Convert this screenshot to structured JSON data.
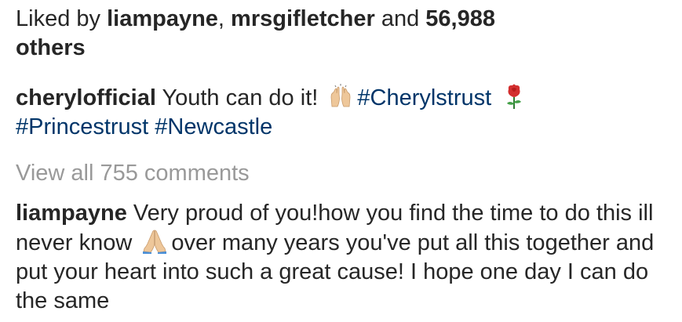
{
  "likes": {
    "prefix": "Liked by ",
    "user1": "liampayne",
    "sep": ", ",
    "user2": "mrsgifletcher",
    "and": " and ",
    "count": "56,988",
    "others": "others"
  },
  "caption": {
    "username": "cherylofficial",
    "text": " Youth can do it! ",
    "hashtag1": "#Cherylstrust",
    "hashtag2": "#Princestrust",
    "hashtag3": "#Newcastle",
    "emoji1": "raising-hands-emoji",
    "emoji2": "rose-emoji"
  },
  "view_all": "View all 755 comments",
  "comment": {
    "username": "liampayne",
    "text_part1": " Very proud of you!how you find the time to do this ill never know ",
    "emoji": "folded-hands-emoji",
    "text_part2": "over many years you've put all this together and put your heart into such a great cause! I hope one day I can do the same"
  },
  "colors": {
    "text": "#262626",
    "hashtag": "#003569",
    "muted": "#999999"
  }
}
